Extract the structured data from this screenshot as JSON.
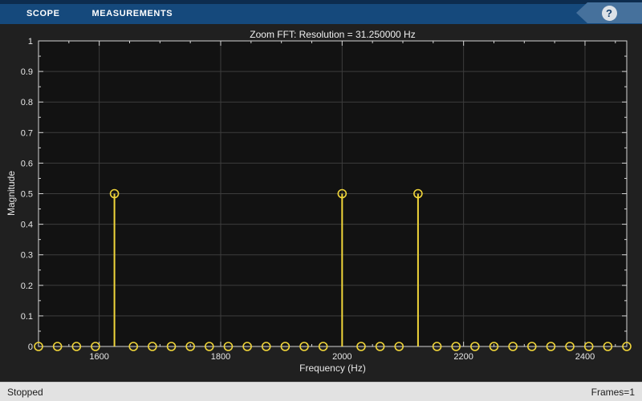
{
  "toolbar": {
    "tabs": [
      {
        "label": "SCOPE"
      },
      {
        "label": "MEASUREMENTS"
      }
    ],
    "help_icon": "?"
  },
  "chart_data": {
    "type": "stem",
    "title": "Zoom FFT: Resolution = 31.250000 Hz",
    "xlabel": "Frequency (Hz)",
    "ylabel": "Magnitude",
    "xlim": [
      1500,
      2468.75
    ],
    "ylim": [
      0,
      1
    ],
    "grid": true,
    "legend": "none",
    "bin_spacing_hz": 31.25,
    "x_ticks": [
      1600,
      1800,
      2000,
      2200,
      2400
    ],
    "x_tick_labels": [
      "1600",
      "1800",
      "2000",
      "2200",
      "2400"
    ],
    "x_minor_tick_step": 50,
    "y_ticks": [
      0,
      0.1,
      0.2,
      0.3,
      0.4,
      0.5,
      0.6,
      0.7,
      0.8,
      0.9,
      1
    ],
    "y_tick_labels": [
      "0",
      "0.1",
      "0.2",
      "0.3",
      "0.4",
      "0.5",
      "0.6",
      "0.7",
      "0.8",
      "0.9",
      "1"
    ],
    "y_minor_tick_step": 0.05,
    "x": [
      1500,
      1531.25,
      1562.5,
      1593.75,
      1625,
      1656.25,
      1687.5,
      1718.75,
      1750,
      1781.25,
      1812.5,
      1843.75,
      1875,
      1906.25,
      1937.5,
      1968.75,
      2000,
      2031.25,
      2062.5,
      2093.75,
      2125,
      2156.25,
      2187.5,
      2218.75,
      2250,
      2281.25,
      2312.5,
      2343.75,
      2375,
      2406.25,
      2437.5,
      2468.75
    ],
    "y": [
      0,
      0,
      0,
      0,
      0.5,
      0,
      0,
      0,
      0,
      0,
      0,
      0,
      0,
      0,
      0,
      0,
      0.5,
      0,
      0,
      0,
      0.5,
      0,
      0,
      0,
      0,
      0,
      0,
      0,
      0,
      0,
      0,
      0
    ],
    "peaks": [
      {
        "freq_hz": 1625,
        "magnitude": 0.5
      },
      {
        "freq_hz": 2000,
        "magnitude": 0.5
      },
      {
        "freq_hz": 2125,
        "magnitude": 0.5
      }
    ],
    "colors": {
      "stem": "#f0d53a",
      "plot_bg": "#121212",
      "figure_bg": "#202020",
      "grid": "#3d3d3d",
      "axis": "#d4d4d4",
      "tick_text": "#e6e6e6"
    }
  },
  "status_bar": {
    "left": "Stopped",
    "right": "Frames=1"
  }
}
